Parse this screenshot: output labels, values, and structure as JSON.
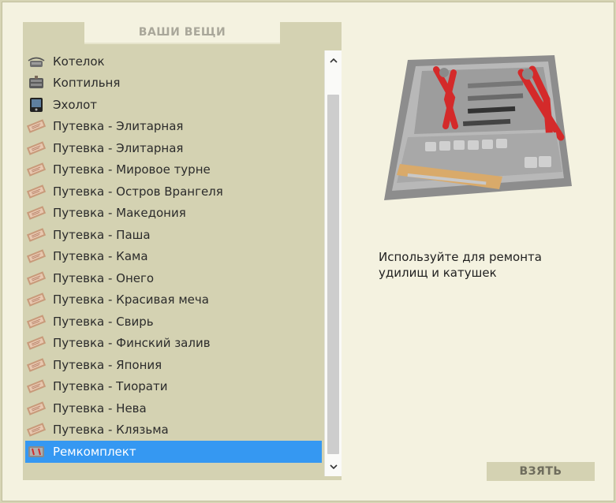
{
  "panel": {
    "title": "ВАШИ ВЕЩИ"
  },
  "items": [
    {
      "label": "Котелок",
      "icon": "pot-icon"
    },
    {
      "label": "Коптильня",
      "icon": "smokehouse-icon"
    },
    {
      "label": "Эхолот",
      "icon": "echo-sounder-icon"
    },
    {
      "label": "Путевка - Элитарная",
      "icon": "ticket-icon"
    },
    {
      "label": "Путевка - Элитарная",
      "icon": "ticket-icon"
    },
    {
      "label": "Путевка - Мировое турне",
      "icon": "ticket-icon"
    },
    {
      "label": "Путевка - Остров Врангеля",
      "icon": "ticket-icon"
    },
    {
      "label": "Путевка - Македония",
      "icon": "ticket-icon"
    },
    {
      "label": "Путевка - Паша",
      "icon": "ticket-icon"
    },
    {
      "label": "Путевка - Кама",
      "icon": "ticket-icon"
    },
    {
      "label": "Путевка - Онего",
      "icon": "ticket-icon"
    },
    {
      "label": "Путевка - Красивая меча",
      "icon": "ticket-icon"
    },
    {
      "label": "Путевка - Свирь",
      "icon": "ticket-icon"
    },
    {
      "label": "Путевка - Финский залив",
      "icon": "ticket-icon"
    },
    {
      "label": "Путевка - Япония",
      "icon": "ticket-icon"
    },
    {
      "label": "Путевка - Тиорати",
      "icon": "ticket-icon"
    },
    {
      "label": "Путевка - Нева",
      "icon": "ticket-icon"
    },
    {
      "label": "Путевка - Клязьма",
      "icon": "ticket-icon"
    },
    {
      "label": "Ремкомплект",
      "icon": "repair-kit-icon",
      "selected": true
    }
  ],
  "preview": {
    "image": "repair-kit-image",
    "description": "Используйте для ремонта удилищ и катушек"
  },
  "actions": {
    "take_label": "ВЗЯТЬ"
  },
  "colors": {
    "selection": "#3598f2",
    "panel": "#d4d2b2",
    "background": "#f4f2e0"
  }
}
